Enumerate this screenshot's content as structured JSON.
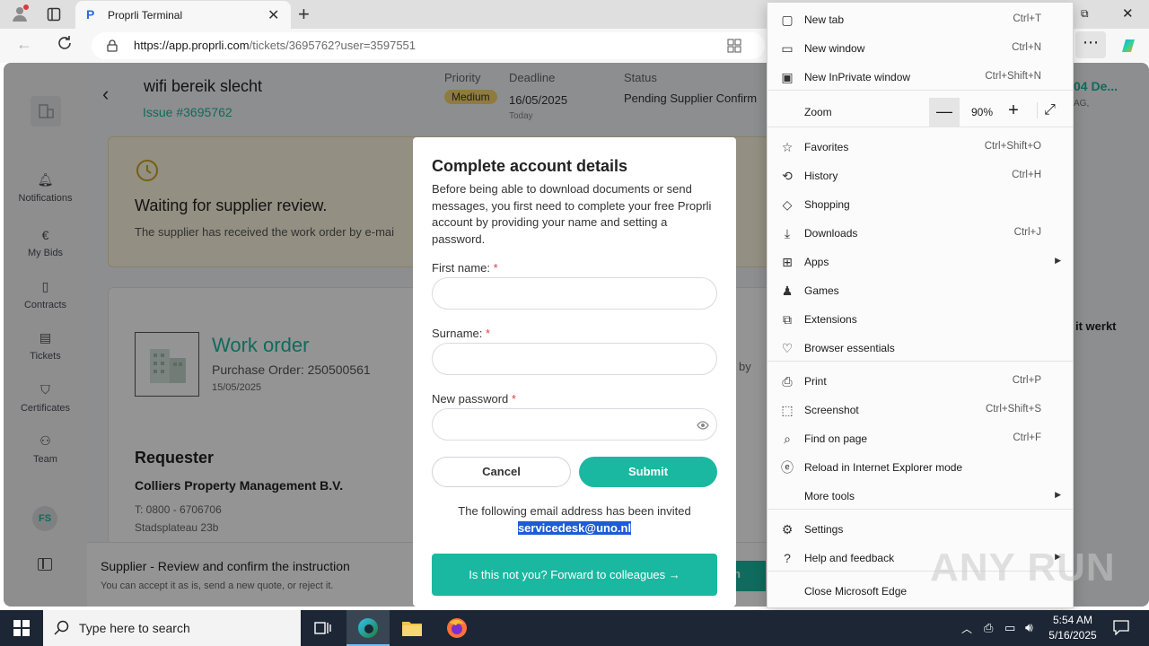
{
  "browser": {
    "tab_title": "Proprli Terminal",
    "url_domain": "https://app.proprli.com",
    "url_path": "/tickets/3695762?user=3597551"
  },
  "app": {
    "ticket_title": "wifi bereik slecht",
    "issue_number": "Issue #3695762",
    "priority_label": "Priority",
    "priority_value": "Medium",
    "deadline_label": "Deadline",
    "deadline_value": "16/05/2025",
    "deadline_sub": "Today",
    "status_label": "Status",
    "status_value": "Pending Supplier Confirm",
    "right_link": "04 De...",
    "right_sub": "AG,",
    "right_text": "it werkt",
    "waiting_title": "Waiting for supplier review.",
    "waiting_text": "The supplier has received the work order by e-mai",
    "work_order_title": "Work order",
    "purchase_order": "Purchase Order: 250500561",
    "work_order_date": "15/05/2025",
    "by_text": "by",
    "requester_title": "Requester",
    "requester_company": "Colliers Property Management B.V.",
    "requester_phone": "T: 0800 - 6706706",
    "requester_address": "Stadsplateau 23b",
    "footer_title": "Supplier - Review and confirm the instruction",
    "footer_text": "You can accept it as is, send a new quote, or reject it.",
    "footer_btn_partial": "n"
  },
  "nav": {
    "items": [
      {
        "label": "Notifications",
        "icon": "bell-icon"
      },
      {
        "label": "My Bids",
        "icon": "euro-icon"
      },
      {
        "label": "Contracts",
        "icon": "contract-icon"
      },
      {
        "label": "Tickets",
        "icon": "ticket-icon"
      },
      {
        "label": "Certificates",
        "icon": "shield-icon"
      },
      {
        "label": "Team",
        "icon": "team-icon"
      }
    ],
    "avatar": "FS"
  },
  "modal": {
    "title": "Complete account details",
    "description": "Before being able to download documents or send messages, you first need to complete your free Proprli account by providing your name and setting a password.",
    "first_name_label": "First name:",
    "surname_label": "Surname:",
    "password_label": "New password",
    "required_mark": "*",
    "cancel": "Cancel",
    "submit": "Submit",
    "invite_text": "The following email address has been invited",
    "email": "servicedesk@uno.nl",
    "forward_btn": "Is this not you? Forward to colleagues"
  },
  "menu": {
    "items": [
      {
        "label": "New tab",
        "shortcut": "Ctrl+T"
      },
      {
        "label": "New window",
        "shortcut": "Ctrl+N"
      },
      {
        "label": "New InPrivate window",
        "shortcut": "Ctrl+Shift+N"
      },
      {
        "label": "Zoom",
        "shortcut": ""
      },
      {
        "label": "Favorites",
        "shortcut": "Ctrl+Shift+O"
      },
      {
        "label": "History",
        "shortcut": "Ctrl+H"
      },
      {
        "label": "Shopping",
        "shortcut": ""
      },
      {
        "label": "Downloads",
        "shortcut": "Ctrl+J"
      },
      {
        "label": "Apps",
        "shortcut": ""
      },
      {
        "label": "Games",
        "shortcut": ""
      },
      {
        "label": "Extensions",
        "shortcut": ""
      },
      {
        "label": "Browser essentials",
        "shortcut": ""
      },
      {
        "label": "Print",
        "shortcut": "Ctrl+P"
      },
      {
        "label": "Screenshot",
        "shortcut": "Ctrl+Shift+S"
      },
      {
        "label": "Find on page",
        "shortcut": "Ctrl+F"
      },
      {
        "label": "Reload in Internet Explorer mode",
        "shortcut": ""
      },
      {
        "label": "More tools",
        "shortcut": ""
      },
      {
        "label": "Settings",
        "shortcut": ""
      },
      {
        "label": "Help and feedback",
        "shortcut": ""
      },
      {
        "label": "Close Microsoft Edge",
        "shortcut": ""
      }
    ],
    "zoom_value": "90%"
  },
  "taskbar": {
    "search_placeholder": "Type here to search",
    "time": "5:54 AM",
    "date": "5/16/2025"
  },
  "watermark": "ANY RUN",
  "colors": {
    "brand_teal": "#1ab8a0",
    "priority_bg": "#f6d56a",
    "email_highlight": "#1e5bd6"
  }
}
